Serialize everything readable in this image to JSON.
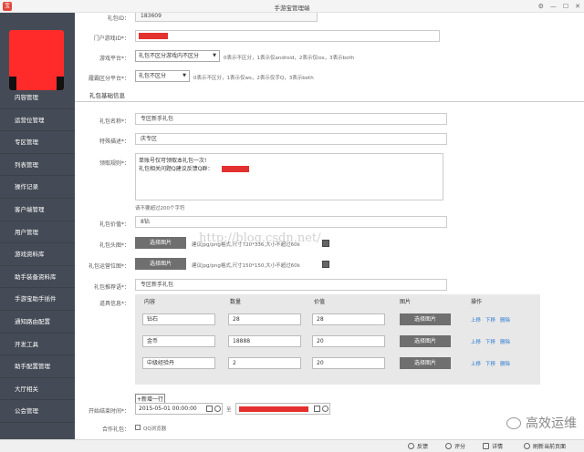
{
  "window": {
    "title": "手游宝管理端",
    "logo_glyph": "宝",
    "controls": [
      "⚙",
      "—",
      "☐",
      "✕"
    ]
  },
  "sidebar": {
    "items": [
      "内容管理",
      "运营位管理",
      "专区管理",
      "列表管理",
      "操作记录",
      "客户端管理",
      "用户管理",
      "游戏资料库",
      "助手装备资料库",
      "手游宝助手插件",
      "通知路由配置",
      "开发工具",
      "助手配置管理",
      "大厅相关",
      "公会管理"
    ]
  },
  "form": {
    "gift_id": {
      "label": "礼包ID：",
      "value": "183609"
    },
    "portal_game_id": {
      "label": "门户游戏ID*："
    },
    "game_platform": {
      "label": "游戏平台*：",
      "select": "礼包不区分游戏内不区分",
      "hint": "0表示不区分，1表示仅android，2表示仅ios，3表示both"
    },
    "hall_platform": {
      "label": "履霸区分平台*：",
      "select": "礼包不区分",
      "hint": "0表示不区分，1表示仅ws，2表示仅手Q，3表示both"
    },
    "section_title": "礼包基础信息",
    "gift_name": {
      "label": "礼包名称*：",
      "value": "专区新手礼包"
    },
    "special_desc": {
      "label": "特殊描述*：",
      "value": "庆专区"
    },
    "claim_rules": {
      "label": "领取规则*：",
      "line1": "单账号仅可领取本礼包一次!",
      "line2": "礼包相关问题Q建议反馈Q群：",
      "hint": "请不要超过200个字符"
    },
    "gift_value": {
      "label": "礼包价值*：",
      "value": "8钻"
    },
    "gift_icon": {
      "label": "礼包头图*：",
      "button": "选择图片",
      "hint": "建议jpg/png格式,尺寸720*336,大小不超过60k"
    },
    "gift_promo": {
      "label": "礼包运营位图*：",
      "button": "选择图片",
      "hint": "建议jpg/png格式,尺寸150*150,大小不超过60k"
    },
    "gift_recommend": {
      "label": "礼包推荐语*：",
      "value": "专区新手礼包"
    },
    "props": {
      "label": "道具信息*：",
      "headers": [
        "内容",
        "数量",
        "价值",
        "图片",
        "操作"
      ],
      "rows": [
        {
          "name": "钻石",
          "qty": "28",
          "value": "28"
        },
        {
          "name": "金币",
          "qty": "18888",
          "value": "20"
        },
        {
          "name": "中级经验丹",
          "qty": "2",
          "value": "20"
        }
      ],
      "choose": "选择图片",
      "ops": [
        "上移",
        "下移",
        "删除"
      ],
      "add": "+新增一行"
    },
    "time": {
      "label": "开始结束时间*：",
      "start": "2015-05-01 00:00:00",
      "to": "至"
    },
    "cooperate": {
      "label": "合作礼包：",
      "option": "QQ浏览器"
    }
  },
  "watermark": "http://blog.csdn.net/",
  "wechat_brand": "高效运维",
  "statusbar": {
    "feedback": "反馈",
    "rate": "评分",
    "detail": "详情",
    "refresh": "刷新当前页面"
  }
}
